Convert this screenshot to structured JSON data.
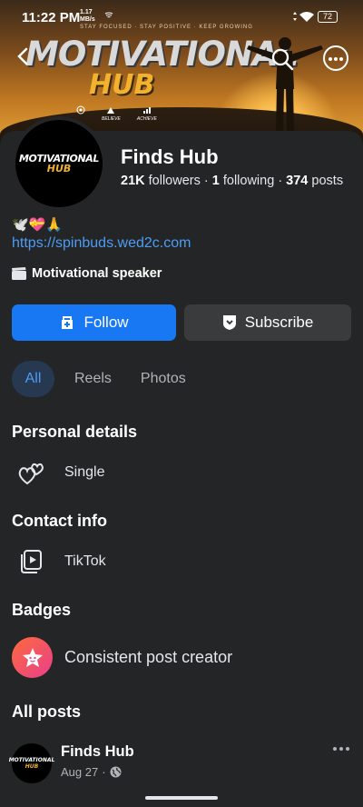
{
  "status_bar": {
    "time": "11:22 PM",
    "speed_value": "1.17",
    "speed_unit": "MB/s",
    "battery": "72"
  },
  "cover": {
    "tagline": "STAY FOCUSED · STAY POSITIVE · KEEP GROWING",
    "title_line1": "MOTIVATIONAL",
    "title_line2": "HUB",
    "icon_labels": [
      "BELIEVE",
      "ACHIEVE"
    ]
  },
  "avatar": {
    "line1": "MOTIVATIONAL",
    "line2": "HUB"
  },
  "profile": {
    "name": "Finds Hub",
    "followers_count": "21K",
    "followers_label": "followers",
    "following_count": "1",
    "following_label": "following",
    "posts_count": "374",
    "posts_label": "posts",
    "bio_emojis": "🕊️💝🙏",
    "website": "https://spinbuds.wed2c.com",
    "category": "Motivational speaker"
  },
  "actions": {
    "follow_label": "Follow",
    "subscribe_label": "Subscribe"
  },
  "tabs": [
    {
      "label": "All",
      "active": true
    },
    {
      "label": "Reels",
      "active": false
    },
    {
      "label": "Photos",
      "active": false
    }
  ],
  "sections": {
    "personal_details": {
      "heading": "Personal details",
      "relationship": "Single"
    },
    "contact_info": {
      "heading": "Contact info",
      "platform": "TikTok"
    },
    "badges": {
      "heading": "Badges",
      "badge": "Consistent post creator"
    },
    "all_posts": {
      "heading": "All posts"
    }
  },
  "post": {
    "author": "Finds Hub",
    "date": "Aug 27",
    "avatar_line1": "MOTIVATIONAL",
    "avatar_line2": "HUB"
  },
  "colors": {
    "accent": "#1877f2",
    "link": "#4d9cf5",
    "background": "#242526",
    "secondary_button": "#3a3b3c"
  }
}
